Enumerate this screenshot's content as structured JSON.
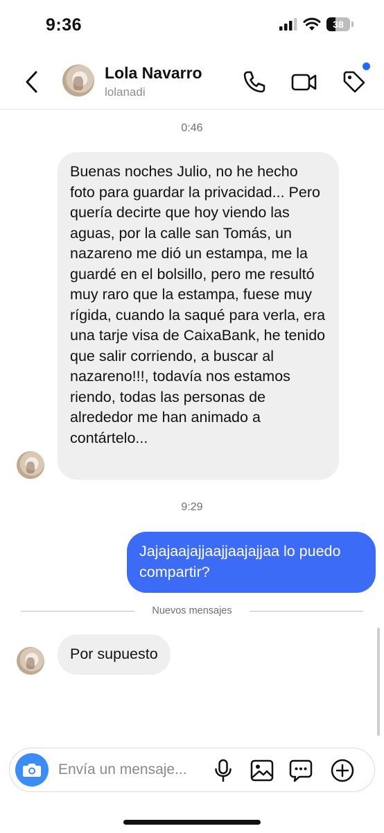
{
  "status_bar": {
    "time": "9:36",
    "battery": "38",
    "battery_level": 0.38
  },
  "header": {
    "name": "Lola Navarro",
    "username": "lolanadi"
  },
  "conversation": {
    "timestamp_1": "0:46",
    "message_1": "Buenas noches Julio, no he hecho foto para guardar la privacidad... Pero quería decirte que hoy viendo las aguas, por la calle san Tomás, un nazareno me dió un estampa, me la guardé en el bolsillo, pero me resultó muy raro que la estampa, fuese muy rígida, cuando la saqué para verla, era una tarje visa de CaixaBank, he tenido que salir corriendo, a buscar al nazareno!!!, todavía nos estamos riendo, todas las personas de alrededor me han animado a contártelo...",
    "timestamp_2": "9:29",
    "message_2": "Jajajaajajjaajjaajajjaa lo puedo compartir?",
    "new_messages_label": "Nuevos mensajes",
    "message_3": "Por supuesto"
  },
  "composer": {
    "placeholder": "Envía un mensaje..."
  },
  "icons": {
    "back": "chevron-left-icon",
    "call": "phone-icon",
    "video": "video-camera-icon",
    "tag": "tag-icon",
    "camera": "camera-icon",
    "mic": "microphone-icon",
    "gallery": "image-icon",
    "sticker": "chat-bubble-icon",
    "more": "plus-circle-icon"
  },
  "colors": {
    "outgoing_bubble": "#3c6cf5",
    "incoming_bubble": "#efefef",
    "camera_button": "#3c8cf5",
    "notification_dot": "#1f6bff"
  }
}
